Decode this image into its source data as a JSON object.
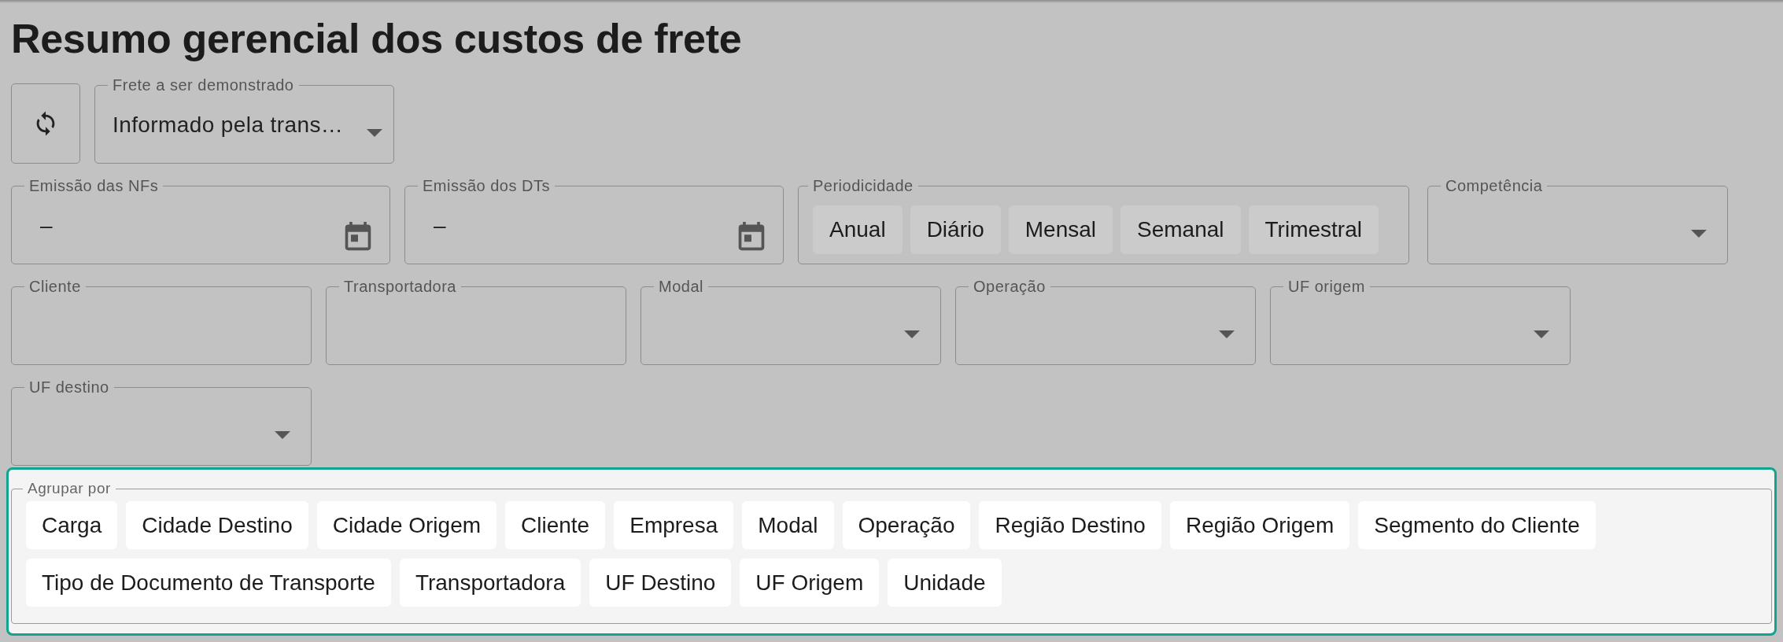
{
  "title": "Resumo gerencial dos custos de frete",
  "freight_select": {
    "label": "Frete a ser demonstrado",
    "value": "Informado pela trans…"
  },
  "date_fields": [
    {
      "label": "Emissão das NFs",
      "value": "–"
    },
    {
      "label": "Emissão dos DTs",
      "value": "–"
    }
  ],
  "periodicity": {
    "label": "Periodicidade",
    "options": [
      {
        "label": "Anual",
        "selected": false
      },
      {
        "label": "Diário",
        "selected": false
      },
      {
        "label": "Mensal",
        "selected": false
      },
      {
        "label": "Semanal",
        "selected": false
      },
      {
        "label": "Trimestral",
        "selected": false
      }
    ]
  },
  "competence": {
    "label": "Competência"
  },
  "filters": [
    {
      "label": "Cliente",
      "kind": "text"
    },
    {
      "label": "Transportadora",
      "kind": "text"
    },
    {
      "label": "Modal",
      "kind": "select"
    },
    {
      "label": "Operação",
      "kind": "select"
    },
    {
      "label": "UF origem",
      "kind": "select"
    },
    {
      "label": "UF destino",
      "kind": "select"
    }
  ],
  "group_by": {
    "label": "Agrupar por",
    "options": [
      {
        "label": "Carga",
        "selected": false
      },
      {
        "label": "Cidade Destino",
        "selected": false
      },
      {
        "label": "Cidade Origem",
        "selected": false
      },
      {
        "label": "Cliente",
        "selected": false
      },
      {
        "label": "Empresa",
        "selected": false
      },
      {
        "label": "Modal",
        "selected": false
      },
      {
        "label": "Operação",
        "selected": false
      },
      {
        "label": "Região Destino",
        "selected": false
      },
      {
        "label": "Região Origem",
        "selected": false
      },
      {
        "label": "Segmento do Cliente",
        "selected": false
      },
      {
        "label": "Tipo de Documento de Transporte",
        "selected": false
      },
      {
        "label": "Transportadora",
        "selected": false
      },
      {
        "label": "UF Destino",
        "selected": false
      },
      {
        "label": "UF Origem",
        "selected": false
      },
      {
        "label": "Unidade",
        "selected": false
      }
    ]
  }
}
